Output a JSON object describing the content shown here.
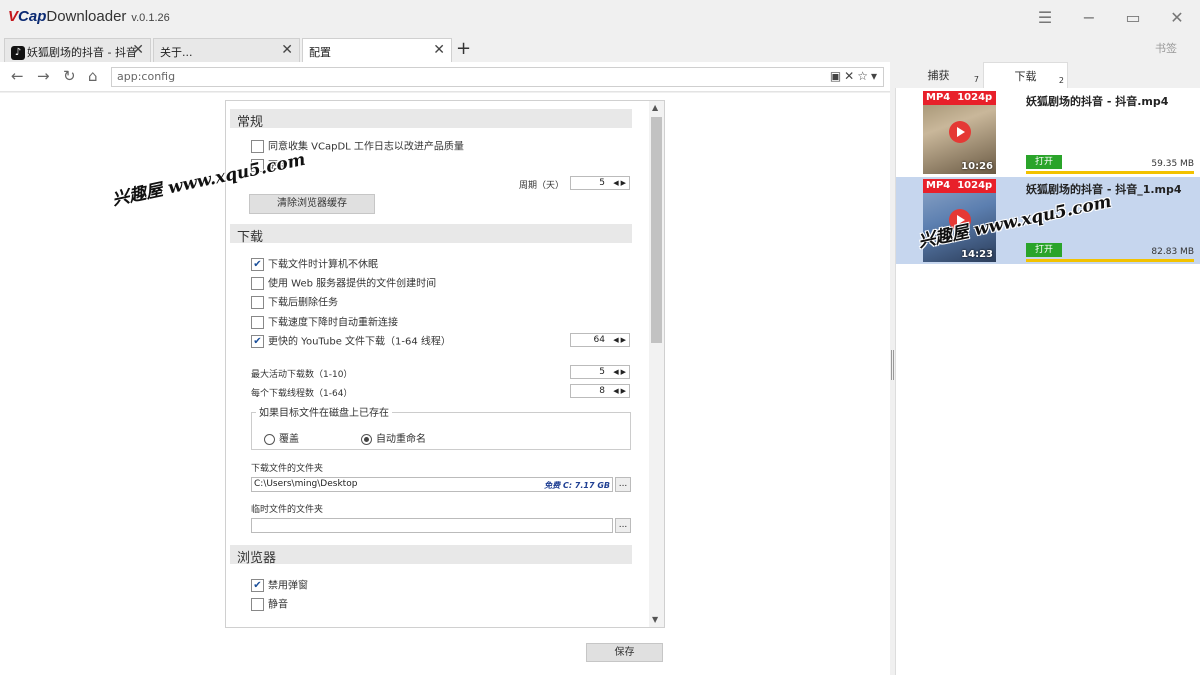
{
  "app": {
    "logo_v": "V",
    "logo_cap": "Cap",
    "logo_rest": "Downloader",
    "version": "v.0.1.26"
  },
  "window_controls": {
    "menu": "☰",
    "minimize": "−",
    "maximize": "▭",
    "close": "✕"
  },
  "tabs": [
    {
      "label": "妖狐剧场的抖音 - 抖音",
      "close": "✕"
    },
    {
      "label": "关于...",
      "close": "✕"
    },
    {
      "label": "配置",
      "close": "✕"
    }
  ],
  "new_tab": "+",
  "bookmarks_label": "书签",
  "address": {
    "url": "app:config",
    "icons": "▣✕☆▾"
  },
  "nav": {
    "back": "←",
    "forward": "→",
    "reload": "↻",
    "home": "⌂"
  },
  "config": {
    "general": {
      "header": "常规",
      "collect_logs": {
        "label": "同意收集 VCapDL 工作日志以改进产品质量",
        "checked": false
      },
      "auto_update": {
        "label": "更新",
        "checked": false
      },
      "period_label": "周期（天）",
      "period_value": "5",
      "clear_cache_button": "清除浏览器缓存"
    },
    "download": {
      "header": "下载",
      "options": [
        {
          "label": "下载文件时计算机不休眠",
          "checked": true
        },
        {
          "label": "使用 Web 服务器提供的文件创建时间",
          "checked": false
        },
        {
          "label": "下载后删除任务",
          "checked": false
        },
        {
          "label": "下载速度下降时自动重新连接",
          "checked": false
        },
        {
          "label": "更快的 YouTube 文件下载（1-64 线程）",
          "checked": true
        }
      ],
      "youtube_threads": "64",
      "max_active_label": "最大活动下载数（1-10）",
      "max_active_value": "5",
      "threads_per_label": "每个下载线程数（1-64）",
      "threads_per_value": "8",
      "exists_group_title": "如果目标文件在磁盘上已存在",
      "overwrite_label": "覆盖",
      "rename_label": "自动重命名",
      "selected": "rename",
      "folder_label": "下载文件的文件夹",
      "folder_path": "C:\\Users\\ming\\Desktop",
      "free_space": "免费 C: 7.17 GB",
      "temp_folder_label": "临时文件的文件夹",
      "temp_folder_path": "",
      "browse": "..."
    },
    "browser": {
      "header": "浏览器",
      "disable_popups": {
        "label": "禁用弹窗",
        "checked": true
      },
      "mute": {
        "label": "静音",
        "checked": false
      }
    },
    "save_button": "保存",
    "checkmark": "✔"
  },
  "watermark": "兴趣屋 www.xqu5.com",
  "right_panel": {
    "tabs": [
      {
        "label": "捕获",
        "count": "7"
      },
      {
        "label": "下载",
        "count": "2"
      }
    ],
    "downloads": [
      {
        "format": "MP4",
        "quality": "1024p",
        "duration": "10:26",
        "filename": "妖狐剧场的抖音 - 抖音.mp4",
        "open": "打开",
        "size": "59.35 MB",
        "progress": 1.0
      },
      {
        "format": "MP4",
        "quality": "1024p",
        "duration": "14:23",
        "filename": "妖狐剧场的抖音 - 抖音_1.mp4",
        "open": "打开",
        "size": "82.83 MB",
        "progress": 1.0
      }
    ]
  },
  "colors": {
    "accent_red": "#e8202a",
    "open_green": "#2aa42a",
    "progress_yellow": "#f2c200",
    "selected_row": "#c6d6ee"
  }
}
